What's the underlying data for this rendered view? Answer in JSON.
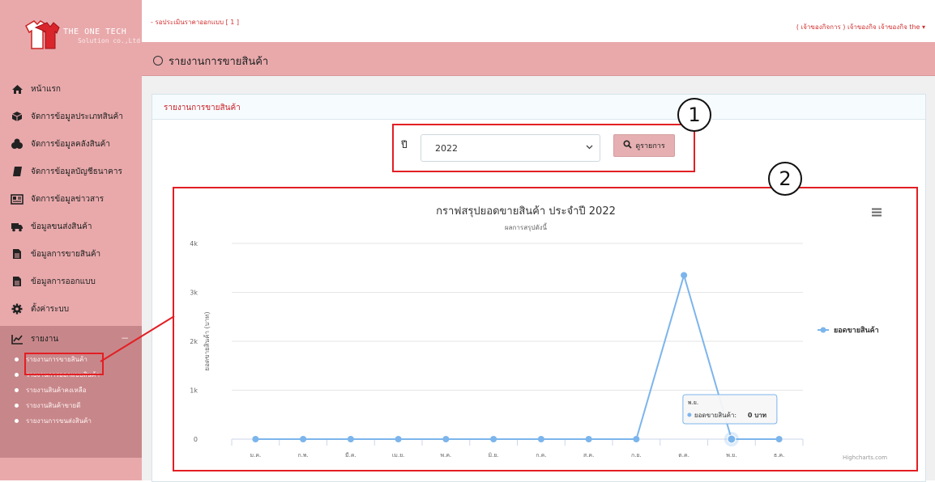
{
  "brand": {
    "name": "THE ONE TECH",
    "subname": "Solution co.,Ltd"
  },
  "topbar": {
    "link": "- รอประเมินราคาออกแบบ [ 1 ]",
    "user": "( เจ้าของกิจการ ) เจ้าของกิจ เจ้าของกิจ the ▾"
  },
  "page_title": "รายงานการขายสินค้า",
  "sidebar": {
    "items": [
      {
        "label": "หน้าแรก",
        "icon": "home-icon"
      },
      {
        "label": "จัดการข้อมูลประเภทสินค้า",
        "icon": "cube-icon"
      },
      {
        "label": "จัดการข้อมูลคลังสินค้า",
        "icon": "cubes-icon"
      },
      {
        "label": "จัดการข้อมูลบัญชีธนาคาร",
        "icon": "book-icon"
      },
      {
        "label": "จัดการข้อมูลข่าวสาร",
        "icon": "newspaper-icon"
      },
      {
        "label": "ข้อมูลขนส่งสินค้า",
        "icon": "truck-icon"
      },
      {
        "label": "ข้อมูลการขายสินค้า",
        "icon": "document-icon"
      },
      {
        "label": "ข้อมูลการออกแบบ",
        "icon": "document-icon"
      },
      {
        "label": "ตั้งค่าระบบ",
        "icon": "gear-icon"
      }
    ],
    "report": {
      "label": "รายงาน",
      "collapse_symbol": "−",
      "subitems": [
        "รายงานการขายสินค้า",
        "รายงานการออกแบบสินค้า",
        "รายงานสินค้าคงเหลือ",
        "รายงานสินค้าขายดี",
        "รายงานการขนส่งสินค้า"
      ]
    }
  },
  "panel": {
    "title": "รายงานการขายสินค้า",
    "year_label": "ปี",
    "year_value": "2022",
    "search_label": "ดูรายการ"
  },
  "callouts": [
    "1",
    "2"
  ],
  "chart_data": {
    "type": "line",
    "title": "กราฟสรุปยอดขายสินค้า ประจำปี 2022",
    "subtitle": "ผลการสรุปดังนี้",
    "ylabel": "ยอดขายสินค้า (บาท)",
    "xlabel": "",
    "categories": [
      "ม.ค.",
      "ก.พ.",
      "มี.ค.",
      "เม.ย.",
      "พ.ค.",
      "มิ.ย.",
      "ก.ค.",
      "ส.ค.",
      "ก.ย.",
      "ต.ค.",
      "พ.ย.",
      "ธ.ค."
    ],
    "series": [
      {
        "name": "ยอดขายสินค้า",
        "values": [
          0,
          0,
          0,
          0,
          0,
          0,
          0,
          0,
          0,
          3350,
          0,
          0
        ]
      }
    ],
    "ylim": [
      0,
      4000
    ],
    "yticks": [
      0,
      1000,
      2000,
      3000,
      4000
    ],
    "ytick_labels": [
      "0",
      "1k",
      "2k",
      "3k",
      "4k"
    ],
    "grid": true,
    "legend_position": "right",
    "color": "#7cb5ec",
    "tooltip": {
      "category": "พ.ย.",
      "series_label": "ยอดขายสินค้า:",
      "value": "0 บาท"
    },
    "credit": "Highcharts.com"
  }
}
